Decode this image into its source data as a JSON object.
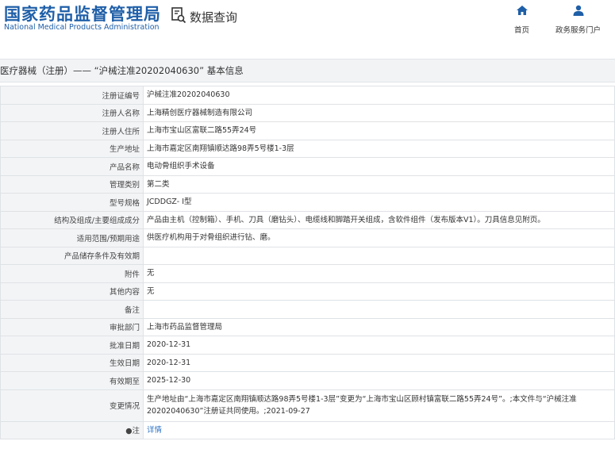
{
  "header": {
    "logo_cn": "国家药品监督管理局",
    "logo_en": "National Medical Products Administration",
    "query": "数据查询",
    "nav": [
      {
        "label": "首页",
        "icon": "home-icon"
      },
      {
        "label": "政务服务门户",
        "icon": "user-icon"
      }
    ]
  },
  "breadcrumb": "医疗器械（注册）—— “沪械注准20202040630” 基本信息",
  "rows": [
    {
      "label": "注册证编号",
      "value": "沪械注准20202040630"
    },
    {
      "label": "注册人名称",
      "value": "上海精创医疗器械制造有限公司"
    },
    {
      "label": "注册人住所",
      "value": "上海市宝山区富联二路55弄24号"
    },
    {
      "label": "生产地址",
      "value": "上海市嘉定区南翔镇顺达路98弄5号楼1-3层"
    },
    {
      "label": "产品名称",
      "value": "电动骨组织手术设备"
    },
    {
      "label": "管理类别",
      "value": "第二类"
    },
    {
      "label": "型号规格",
      "value": "JCDDGZ- Ⅰ型"
    },
    {
      "label": "结构及组成/主要组成成分",
      "value": "产品由主机（控制箱）、手机、刀具（磨钻头）、电缆线和脚踏开关组成，含软件组件（发布版本V1）。刀具信息见附页。"
    },
    {
      "label": "适用范围/预期用途",
      "value": "供医疗机构用于对骨组织进行钻、磨。"
    },
    {
      "label": "产品储存条件及有效期",
      "value": ""
    },
    {
      "label": "附件",
      "value": "无"
    },
    {
      "label": "其他内容",
      "value": "无"
    },
    {
      "label": "备注",
      "value": ""
    },
    {
      "label": "审批部门",
      "value": "上海市药品监督管理局"
    },
    {
      "label": "批准日期",
      "value": "2020-12-31"
    },
    {
      "label": "生效日期",
      "value": "2020-12-31"
    },
    {
      "label": "有效期至",
      "value": "2025-12-30"
    },
    {
      "label": "变更情况",
      "value": "生产地址由“上海市嘉定区南翔镇顺达路98弄5号楼1-3层”变更为“上海市宝山区顾村镇富联二路55弄24号”。;本文件与“沪械注准20202040630”注册证共同使用。;2021-09-27"
    }
  ],
  "note": {
    "label": "●注",
    "link": "详情"
  },
  "colors": {
    "brand": "#1f5fa8",
    "link": "#2f72c4"
  }
}
